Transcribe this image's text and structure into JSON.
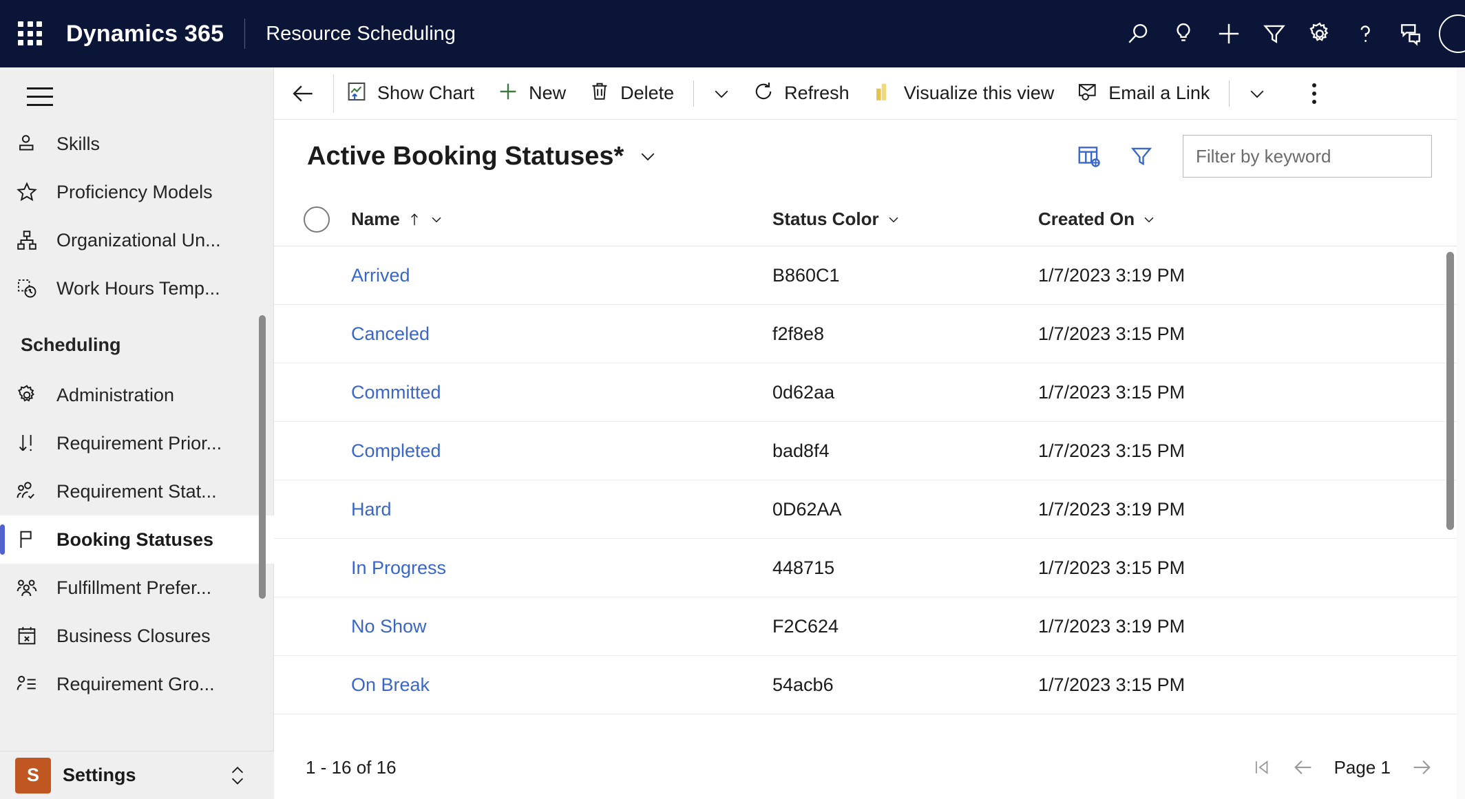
{
  "topbar": {
    "waffle_label": "App launcher",
    "brand": "Dynamics 365",
    "app_name": "Resource Scheduling",
    "icons": [
      {
        "name": "search-icon",
        "label": "Search"
      },
      {
        "name": "lightbulb-icon",
        "label": "Ideas"
      },
      {
        "name": "plus-icon",
        "label": "Quick create"
      },
      {
        "name": "filter-icon",
        "label": "Filters"
      },
      {
        "name": "gear-icon",
        "label": "Settings"
      },
      {
        "name": "help-icon",
        "label": "Help"
      },
      {
        "name": "feedback-icon",
        "label": "Feedback"
      }
    ],
    "background_color": "#0b1537"
  },
  "sidebar": {
    "hamburger_label": "Expand or collapse navigation",
    "items": [
      {
        "label": "Skills",
        "icon": "contact-card-icon",
        "selected": false
      },
      {
        "label": "Proficiency Models",
        "icon": "star-icon",
        "selected": false
      },
      {
        "label": "Organizational Un...",
        "icon": "org-chart-icon",
        "selected": false
      },
      {
        "label": "Work Hours Temp...",
        "icon": "clock-template-icon",
        "selected": false
      }
    ],
    "group_title": "Scheduling",
    "group_items": [
      {
        "label": "Administration",
        "icon": "gear-icon",
        "selected": false
      },
      {
        "label": "Requirement Prior...",
        "icon": "sort-priority-icon",
        "selected": false
      },
      {
        "label": "Requirement Stat...",
        "icon": "people-check-icon",
        "selected": false
      },
      {
        "label": "Booking Statuses",
        "icon": "flag-icon",
        "selected": true
      },
      {
        "label": "Fulfillment Prefer...",
        "icon": "people-icon",
        "selected": false
      },
      {
        "label": "Business Closures",
        "icon": "calendar-x-icon",
        "selected": false
      },
      {
        "label": "Requirement Gro...",
        "icon": "person-list-icon",
        "selected": false
      }
    ],
    "settings": {
      "badge": "S",
      "label": "Settings"
    },
    "accent_color": "#4f62d0",
    "settings_badge_color": "#c05621"
  },
  "commandbar": {
    "back_label": "Back",
    "buttons": [
      {
        "label": "Show Chart",
        "icon": "show-chart-icon"
      },
      {
        "label": "New",
        "icon": "plus-icon"
      },
      {
        "label": "Delete",
        "icon": "trash-icon"
      }
    ],
    "refresh": {
      "label": "Refresh",
      "icon": "refresh-icon"
    },
    "visualize": {
      "label": "Visualize this view",
      "icon": "powerbi-icon"
    },
    "email_link": {
      "label": "Email a Link",
      "icon": "email-link-icon"
    },
    "overflow_label": "More commands"
  },
  "view": {
    "title": "Active Booking Statuses*",
    "title_caret_label": "Change view",
    "edit_columns_label": "Edit columns",
    "edit_filters_label": "Edit filters",
    "search": {
      "placeholder": "Filter by keyword",
      "value": ""
    }
  },
  "grid": {
    "select_all_label": "Select all rows",
    "columns": [
      {
        "label": "Name",
        "sort": "asc"
      },
      {
        "label": "Status Color",
        "sort": ""
      },
      {
        "label": "Created On",
        "sort": ""
      }
    ],
    "rows": [
      {
        "name": "Arrived",
        "status_color": "B860C1",
        "created_on": "1/7/2023 3:19 PM"
      },
      {
        "name": "Canceled",
        "status_color": "f2f8e8",
        "created_on": "1/7/2023 3:15 PM"
      },
      {
        "name": "Committed",
        "status_color": "0d62aa",
        "created_on": "1/7/2023 3:15 PM"
      },
      {
        "name": "Completed",
        "status_color": "bad8f4",
        "created_on": "1/7/2023 3:15 PM"
      },
      {
        "name": "Hard",
        "status_color": "0D62AA",
        "created_on": "1/7/2023 3:19 PM"
      },
      {
        "name": "In Progress",
        "status_color": "448715",
        "created_on": "1/7/2023 3:15 PM"
      },
      {
        "name": "No Show",
        "status_color": "F2C624",
        "created_on": "1/7/2023 3:19 PM"
      },
      {
        "name": "On Break",
        "status_color": "54acb6",
        "created_on": "1/7/2023 3:15 PM"
      }
    ],
    "link_color": "#3a66c8"
  },
  "footer": {
    "record_count": "1 - 16 of 16",
    "page_label": "Page 1",
    "first_page_label": "First page",
    "prev_page_label": "Previous page",
    "next_page_label": "Next page"
  }
}
